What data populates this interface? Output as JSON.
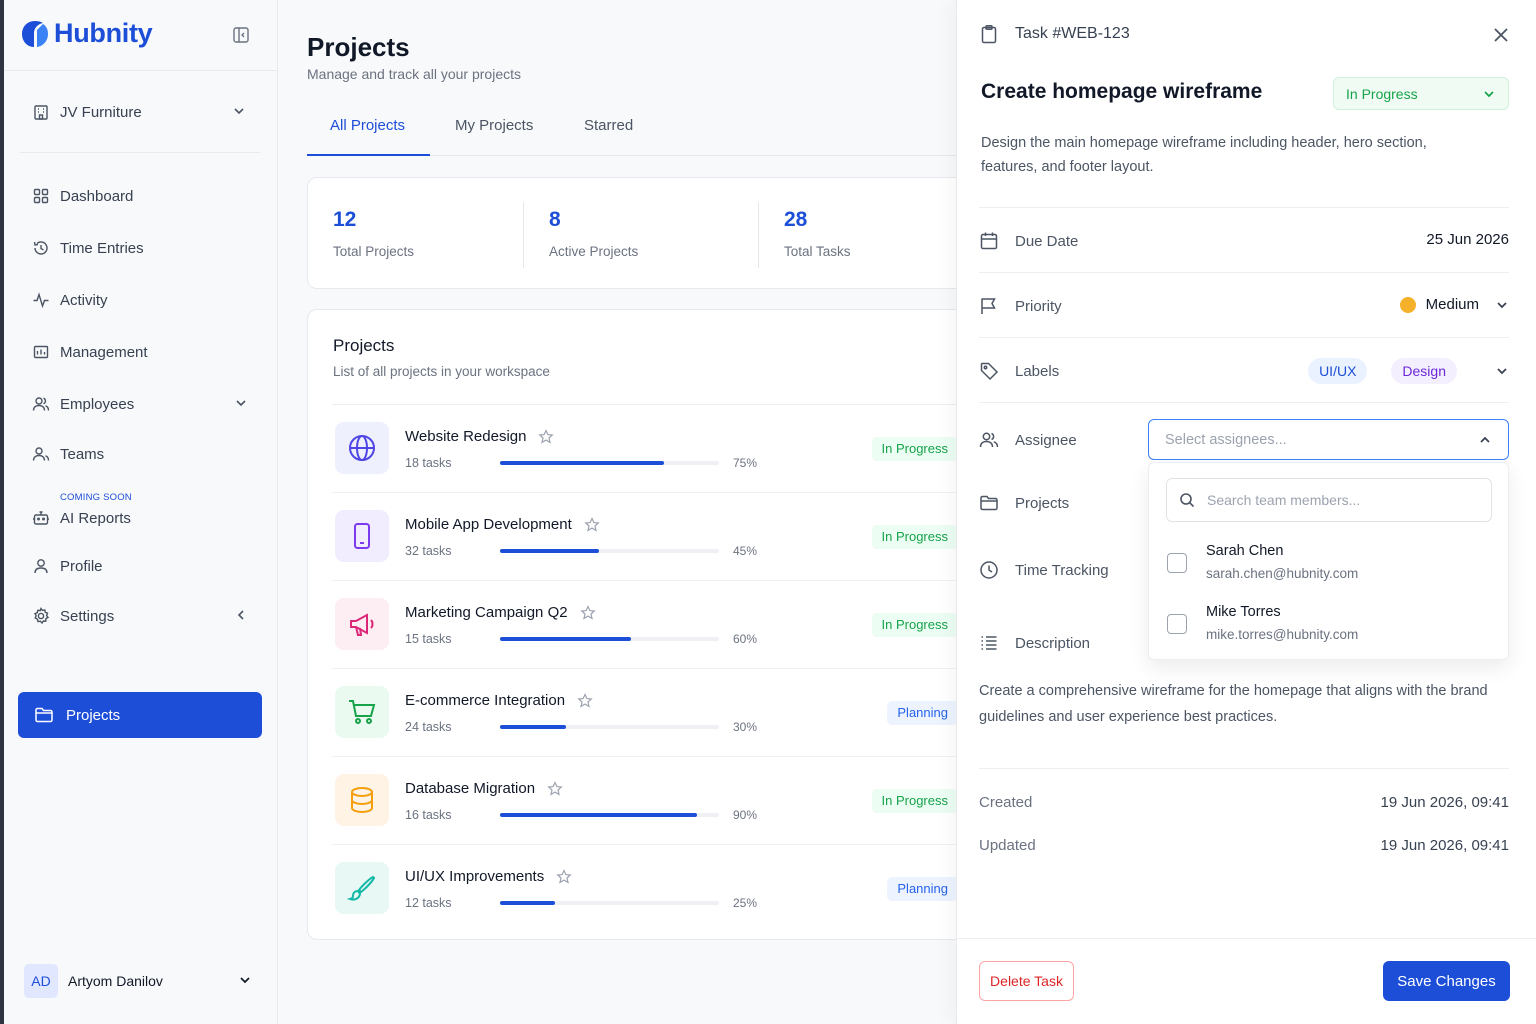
{
  "app": {
    "name": "Hubnity"
  },
  "sidebar": {
    "workspace": "JV Furniture",
    "items": [
      {
        "label": "Dashboard",
        "icon": "grid-icon"
      },
      {
        "label": "Time Entries",
        "icon": "history-icon"
      },
      {
        "label": "Activity",
        "icon": "activity-icon"
      },
      {
        "label": "Management",
        "icon": "calendar-chart-icon"
      },
      {
        "label": "Employees",
        "icon": "users-icon"
      },
      {
        "label": "Teams",
        "icon": "team-icon"
      },
      {
        "label": "AI Reports",
        "icon": "bot-icon",
        "badge": "COMING SOON"
      },
      {
        "label": "Profile",
        "icon": "user-icon"
      },
      {
        "label": "Settings",
        "icon": "gear-icon"
      },
      {
        "label": "Projects",
        "icon": "folder-icon",
        "active": true
      }
    ],
    "user": {
      "initials": "AD",
      "name": "Artyom Danilov"
    }
  },
  "main": {
    "title": "Projects",
    "subtitle": "Manage and track all your projects",
    "tabs": [
      "All Projects",
      "My Projects",
      "Starred"
    ],
    "stats": [
      {
        "value": "12",
        "label": "Total Projects"
      },
      {
        "value": "8",
        "label": "Active Projects"
      },
      {
        "value": "28",
        "label": "Total Tasks"
      }
    ],
    "list": {
      "title": "Projects",
      "subtitle": "List of all projects in your workspace",
      "projects": [
        {
          "name": "Website Redesign",
          "tasks": "18 tasks",
          "progress": 75,
          "progress_label": "75%",
          "status": "In Progress",
          "icon": "globe-icon",
          "color": "#4f46e5",
          "bg": "#eef0fe"
        },
        {
          "name": "Mobile App Development",
          "tasks": "32 tasks",
          "progress": 45,
          "progress_label": "45%",
          "status": "In Progress",
          "icon": "smartphone-icon",
          "color": "#7c3aed",
          "bg": "#f1edff"
        },
        {
          "name": "Marketing Campaign Q2",
          "tasks": "15 tasks",
          "progress": 60,
          "progress_label": "60%",
          "status": "In Progress",
          "icon": "megaphone-icon",
          "color": "#db2777",
          "bg": "#fdeef4"
        },
        {
          "name": "E-commerce Integration",
          "tasks": "24 tasks",
          "progress": 30,
          "progress_label": "30%",
          "status": "Planning",
          "icon": "cart-icon",
          "color": "#16a34a",
          "bg": "#eafaf0"
        },
        {
          "name": "Database Migration",
          "tasks": "16 tasks",
          "progress": 90,
          "progress_label": "90%",
          "status": "In Progress",
          "icon": "database-icon",
          "color": "#f59e0b",
          "bg": "#fff3e6"
        },
        {
          "name": "UI/UX Improvements",
          "tasks": "12 tasks",
          "progress": 25,
          "progress_label": "25%",
          "status": "Planning",
          "icon": "brush-icon",
          "color": "#14b8a6",
          "bg": "#e7f8f5"
        }
      ]
    }
  },
  "panel": {
    "task_id": "Task #WEB-123",
    "title": "Create homepage wireframe",
    "status": "In Progress",
    "description": "Design the main homepage wireframe including header, hero section, features, and footer layout.",
    "fields": {
      "due_date": {
        "label": "Due Date",
        "value": "25 Jun 2026"
      },
      "priority": {
        "label": "Priority",
        "value": "Medium",
        "color": "#f5b12a"
      },
      "labels": {
        "label": "Labels",
        "values": [
          "UI/UX",
          "Design"
        ]
      },
      "assignee": {
        "label": "Assignee",
        "placeholder": "Select assignees..."
      },
      "projects": {
        "label": "Projects"
      },
      "time_tracking": {
        "label": "Time Tracking"
      },
      "description": {
        "label": "Description"
      }
    },
    "assignee_dropdown": {
      "search_placeholder": "Search team members...",
      "members": [
        {
          "name": "Sarah Chen",
          "email": "sarah.chen@hubnity.com",
          "checked": false
        },
        {
          "name": "Mike Torres",
          "email": "mike.torres@hubnity.com",
          "checked": false
        }
      ]
    },
    "long_description": "Create a comprehensive wireframe for the homepage that aligns with the brand guidelines and user experience best practices.",
    "created": {
      "label": "Created",
      "value": "19 Jun 2026, 09:41"
    },
    "updated": {
      "label": "Updated",
      "value": "19 Jun 2026, 09:41"
    },
    "delete_label": "Delete Task",
    "save_label": "Save Changes"
  },
  "colors": {
    "accent": "#1d4ed8",
    "success": "#16a34a",
    "warning": "#f5b12a",
    "danger": "#dc2626"
  }
}
